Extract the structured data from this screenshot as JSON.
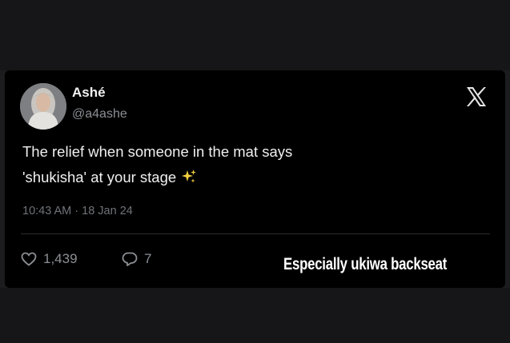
{
  "tweet": {
    "display_name": "Ashé",
    "handle": "@a4ashe",
    "text_line1": "The relief when someone in the mat says",
    "text_line2": "'shukisha' at your stage",
    "timestamp": "10:43 AM · 18 Jan 24",
    "likes": "1,439",
    "replies": "7",
    "platform_icon": "x-logo-icon",
    "emoji": "sparkles"
  },
  "caption": "Especially ukiwa backseat",
  "colors": {
    "background": "#000000",
    "text_primary": "#f0f0f0",
    "text_secondary": "#8b8f94",
    "sparkle": "#f4d03f"
  }
}
